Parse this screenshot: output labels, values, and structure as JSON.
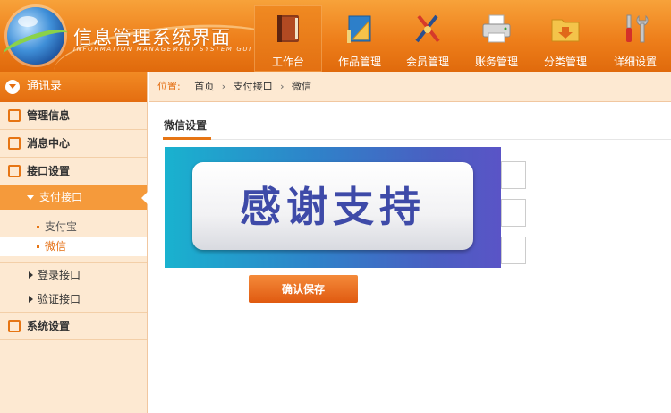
{
  "app": {
    "title": "信息管理系统界面",
    "subtitle": "INFORMATION MANAGEMENT SYSTEM GUI"
  },
  "nav": [
    {
      "label": "工作台",
      "icon": "book-icon",
      "active": true
    },
    {
      "label": "作品管理",
      "icon": "ruler-triangle-icon",
      "active": false
    },
    {
      "label": "会员管理",
      "icon": "drawing-tools-icon",
      "active": false
    },
    {
      "label": "账务管理",
      "icon": "printer-icon",
      "active": false
    },
    {
      "label": "分类管理",
      "icon": "folder-icon",
      "active": false
    },
    {
      "label": "详细设置",
      "icon": "tools-icon",
      "active": false
    }
  ],
  "sidebar": {
    "header": "通讯录",
    "items": [
      {
        "label": "管理信息",
        "icon": "list-icon"
      },
      {
        "label": "消息中心",
        "icon": "message-icon"
      },
      {
        "label": "接口设置",
        "icon": "edit-icon"
      }
    ],
    "expanded": "支付接口",
    "sub_items": [
      "支付宝",
      "微信"
    ],
    "more_items": [
      "登录接口",
      "验证接口"
    ],
    "system": "系统设置"
  },
  "breadcrumb": {
    "position_label": "位置:",
    "parts": [
      "首页",
      "支付接口",
      "微信"
    ]
  },
  "main": {
    "tab": "微信设置",
    "banner_text": "感谢支持",
    "save_button": "确认保存"
  },
  "colors": {
    "accent": "#e67514",
    "header_top": "#f7a23a",
    "sidebar_bg": "#fde9d2",
    "button": "#e05a10"
  }
}
